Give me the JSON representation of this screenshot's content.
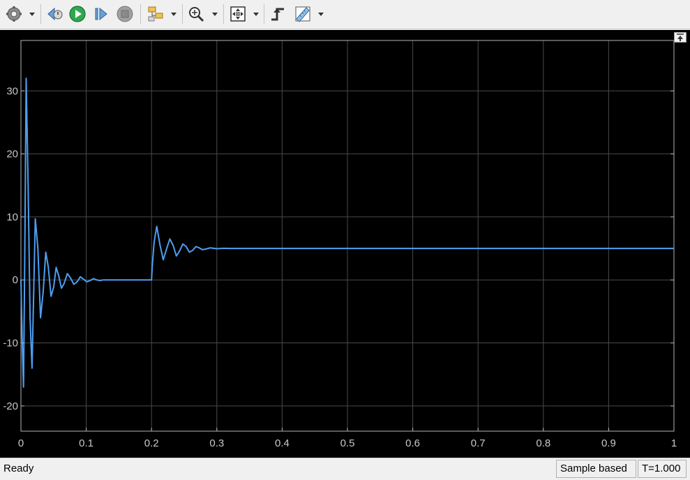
{
  "toolbar": {
    "buttons": [
      {
        "name": "settings-button",
        "icon": "gear-icon",
        "dropdown": true
      },
      {
        "name": "step-back-button",
        "icon": "step-back-icon"
      },
      {
        "name": "run-button",
        "icon": "play-icon"
      },
      {
        "name": "step-forward-button",
        "icon": "step-forward-icon"
      },
      {
        "name": "stop-button",
        "icon": "stop-icon"
      },
      {
        "name": "highlight-block-button",
        "icon": "highlight-block-icon",
        "dropdown": true
      },
      {
        "name": "zoom-button",
        "icon": "zoom-in-icon",
        "dropdown": true
      },
      {
        "name": "autoscale-button",
        "icon": "autoscale-icon",
        "dropdown": true
      },
      {
        "name": "trigger-button",
        "icon": "trigger-icon"
      },
      {
        "name": "measurements-button",
        "icon": "ruler-icon",
        "dropdown": true
      }
    ],
    "accent_colors": {
      "run": "#2fa84f",
      "stop": "#a0a0a0"
    }
  },
  "status": {
    "text": "Ready",
    "mode": "Sample based",
    "time": "T=1.000"
  },
  "chart_data": {
    "type": "line",
    "title": "",
    "xlabel": "",
    "ylabel": "",
    "xlim": [
      0,
      1
    ],
    "ylim": [
      -24,
      38
    ],
    "xticks": [
      0,
      0.1,
      0.2,
      0.3,
      0.4,
      0.5,
      0.6,
      0.7,
      0.8,
      0.9,
      1
    ],
    "xtick_labels": [
      "0",
      "0.1",
      "0.2",
      "0.3",
      "0.4",
      "0.5",
      "0.6",
      "0.7",
      "0.8",
      "0.9",
      "1"
    ],
    "yticks": [
      -20,
      -10,
      0,
      10,
      20,
      30
    ],
    "ytick_labels": [
      "-20",
      "-10",
      "0",
      "10",
      "20",
      "30"
    ],
    "grid": true,
    "background": "#000000",
    "axes_color": "#b4b4b4",
    "series": [
      {
        "color": "#4c9df0",
        "x": [
          0,
          0.002,
          0.004,
          0.006,
          0.008,
          0.011,
          0.014,
          0.017,
          0.022,
          0.026,
          0.03,
          0.034,
          0.038,
          0.042,
          0.046,
          0.05,
          0.054,
          0.058,
          0.062,
          0.066,
          0.071,
          0.076,
          0.081,
          0.086,
          0.091,
          0.096,
          0.101,
          0.106,
          0.111,
          0.116,
          0.121,
          0.126,
          0.13,
          0.2,
          0.201,
          0.204,
          0.208,
          0.213,
          0.218,
          0.223,
          0.228,
          0.233,
          0.238,
          0.243,
          0.248,
          0.253,
          0.258,
          0.263,
          0.268,
          0.273,
          0.278,
          0.283,
          0.29,
          0.3,
          0.31,
          0.32,
          1.0
        ],
        "y": [
          0,
          -10,
          -17,
          5,
          32,
          15,
          -6,
          -14,
          9.7,
          5,
          -6,
          -2,
          4.4,
          2,
          -2.6,
          -1.2,
          2,
          0.6,
          -1.3,
          -0.6,
          1,
          0.3,
          -0.7,
          -0.3,
          0.5,
          0.1,
          -0.3,
          -0.1,
          0.2,
          0,
          -0.1,
          0,
          0,
          0,
          2,
          6,
          8.5,
          5.5,
          3.2,
          4.9,
          6.5,
          5.5,
          3.8,
          4.6,
          5.7,
          5.3,
          4.4,
          4.7,
          5.3,
          5.1,
          4.8,
          4.9,
          5.1,
          4.95,
          5.02,
          5,
          5
        ]
      },
      {
        "color": "#dede4a",
        "x": [
          0,
          0.002,
          0.004,
          0.006,
          0.008,
          0.011,
          0.014,
          0.017,
          0.022,
          0.026,
          0.03,
          0.034,
          0.038,
          0.042,
          0.046,
          0.05,
          0.054,
          0.058,
          0.062,
          0.066,
          0.071,
          0.076,
          0.081,
          0.086,
          0.091,
          0.096,
          0.101,
          0.106,
          0.111,
          0.116,
          0.121,
          0.126,
          0.13,
          0.2,
          0.201,
          0.204,
          0.208,
          0.213,
          0.218,
          0.223,
          0.228,
          0.233,
          0.238,
          0.243,
          0.248,
          0.253,
          0.258,
          0.263,
          0.268,
          0.273,
          0.278,
          0.283,
          0.29,
          0.3,
          0.31,
          0.32,
          1.0
        ],
        "y": [
          0,
          -10,
          -17,
          5,
          32,
          15,
          -6,
          -14,
          9.7,
          5,
          -6,
          -2,
          4.4,
          2,
          -2.6,
          -1.2,
          2,
          0.6,
          -1.3,
          -0.6,
          1,
          0.3,
          -0.7,
          -0.3,
          0.5,
          0.1,
          -0.3,
          -0.1,
          0.2,
          0,
          -0.1,
          0,
          0,
          0,
          2,
          6,
          8.5,
          5.5,
          3.2,
          4.9,
          6.5,
          5.5,
          3.8,
          4.6,
          5.7,
          5.3,
          4.4,
          4.7,
          5.3,
          5.1,
          4.8,
          4.9,
          5.1,
          4.95,
          5.02,
          5,
          5
        ]
      }
    ]
  }
}
